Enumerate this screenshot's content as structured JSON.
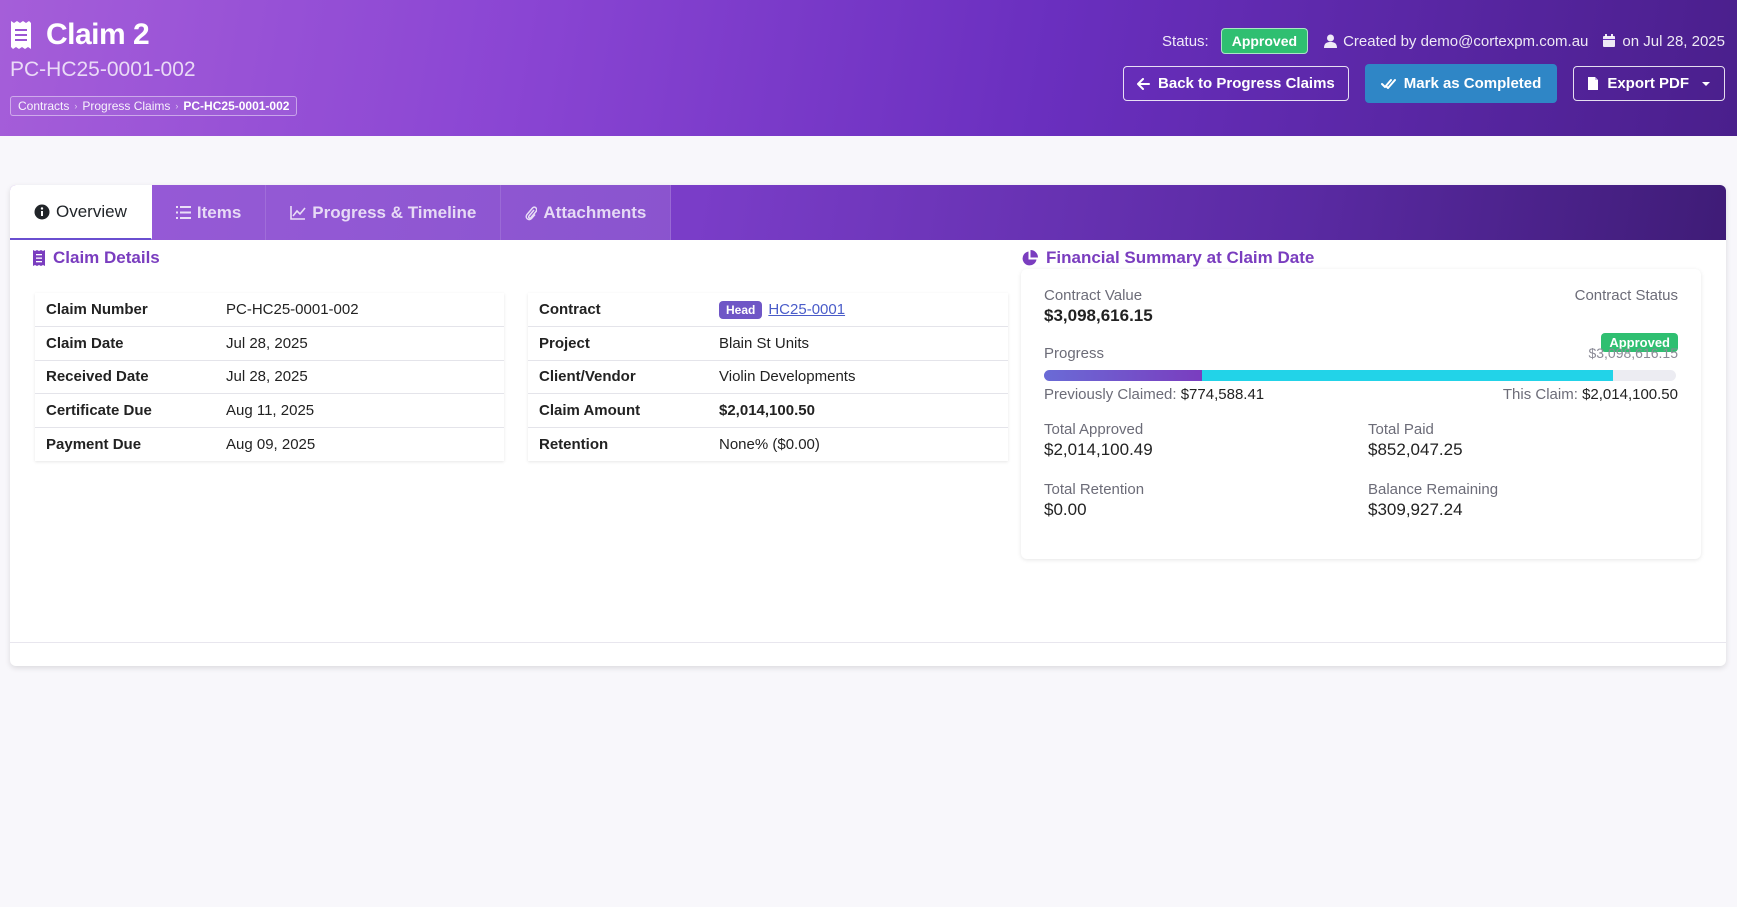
{
  "header": {
    "title": "Claim 2",
    "subtitle": "PC-HC25-0001-002",
    "breadcrumb": [
      "Contracts",
      "Progress Claims",
      "PC-HC25-0001-002"
    ],
    "status_label": "Status:",
    "status_value": "Approved",
    "created_by": "Created by demo@cortexpm.com.au",
    "created_on": "on Jul 28, 2025",
    "buttons": {
      "back": "Back to Progress Claims",
      "complete": "Mark as Completed",
      "export": "Export PDF"
    }
  },
  "tabs": [
    "Overview",
    "Items",
    "Progress & Timeline",
    "Attachments"
  ],
  "claim_details": {
    "title": "Claim Details",
    "left": [
      {
        "label": "Claim Number",
        "value": "PC-HC25-0001-002"
      },
      {
        "label": "Claim Date",
        "value": "Jul 28, 2025"
      },
      {
        "label": "Received Date",
        "value": "Jul 28, 2025"
      },
      {
        "label": "Certificate Due",
        "value": "Aug 11, 2025"
      },
      {
        "label": "Payment Due",
        "value": "Aug 09, 2025"
      }
    ],
    "right": {
      "contract_label": "Contract",
      "contract_badge": "Head",
      "contract_link": "HC25-0001",
      "project_label": "Project",
      "project_value": "Blain St Units",
      "client_label": "Client/Vendor",
      "client_value": "Violin Developments",
      "amount_label": "Claim Amount",
      "amount_value": "$2,014,100.50",
      "retention_label": "Retention",
      "retention_value": "None% ($0.00)"
    }
  },
  "financial": {
    "title": "Financial Summary at Claim Date",
    "contract_value_label": "Contract Value",
    "contract_value": "$3,098,616.15",
    "contract_status_label": "Contract Status",
    "contract_status": "Approved",
    "progress_label": "Progress",
    "progress_total": "$3,098,616.15",
    "progress_prev_fraction": 0.25,
    "progress_this_fraction": 0.65,
    "prev_claimed_label": "Previously Claimed:",
    "prev_claimed": "$774,588.41",
    "this_claim_label": "This Claim:",
    "this_claim": "$2,014,100.50",
    "total_approved_label": "Total Approved",
    "total_approved": "$2,014,100.49",
    "total_paid_label": "Total Paid",
    "total_paid": "$852,047.25",
    "total_retention_label": "Total Retention",
    "total_retention": "$0.00",
    "balance_label": "Balance Remaining",
    "balance": "$309,927.24"
  },
  "colors": {
    "accent": "#7a3dbf",
    "success": "#2fbf71",
    "info_button": "#2f86c6",
    "progress_current": "#22d3e8"
  }
}
